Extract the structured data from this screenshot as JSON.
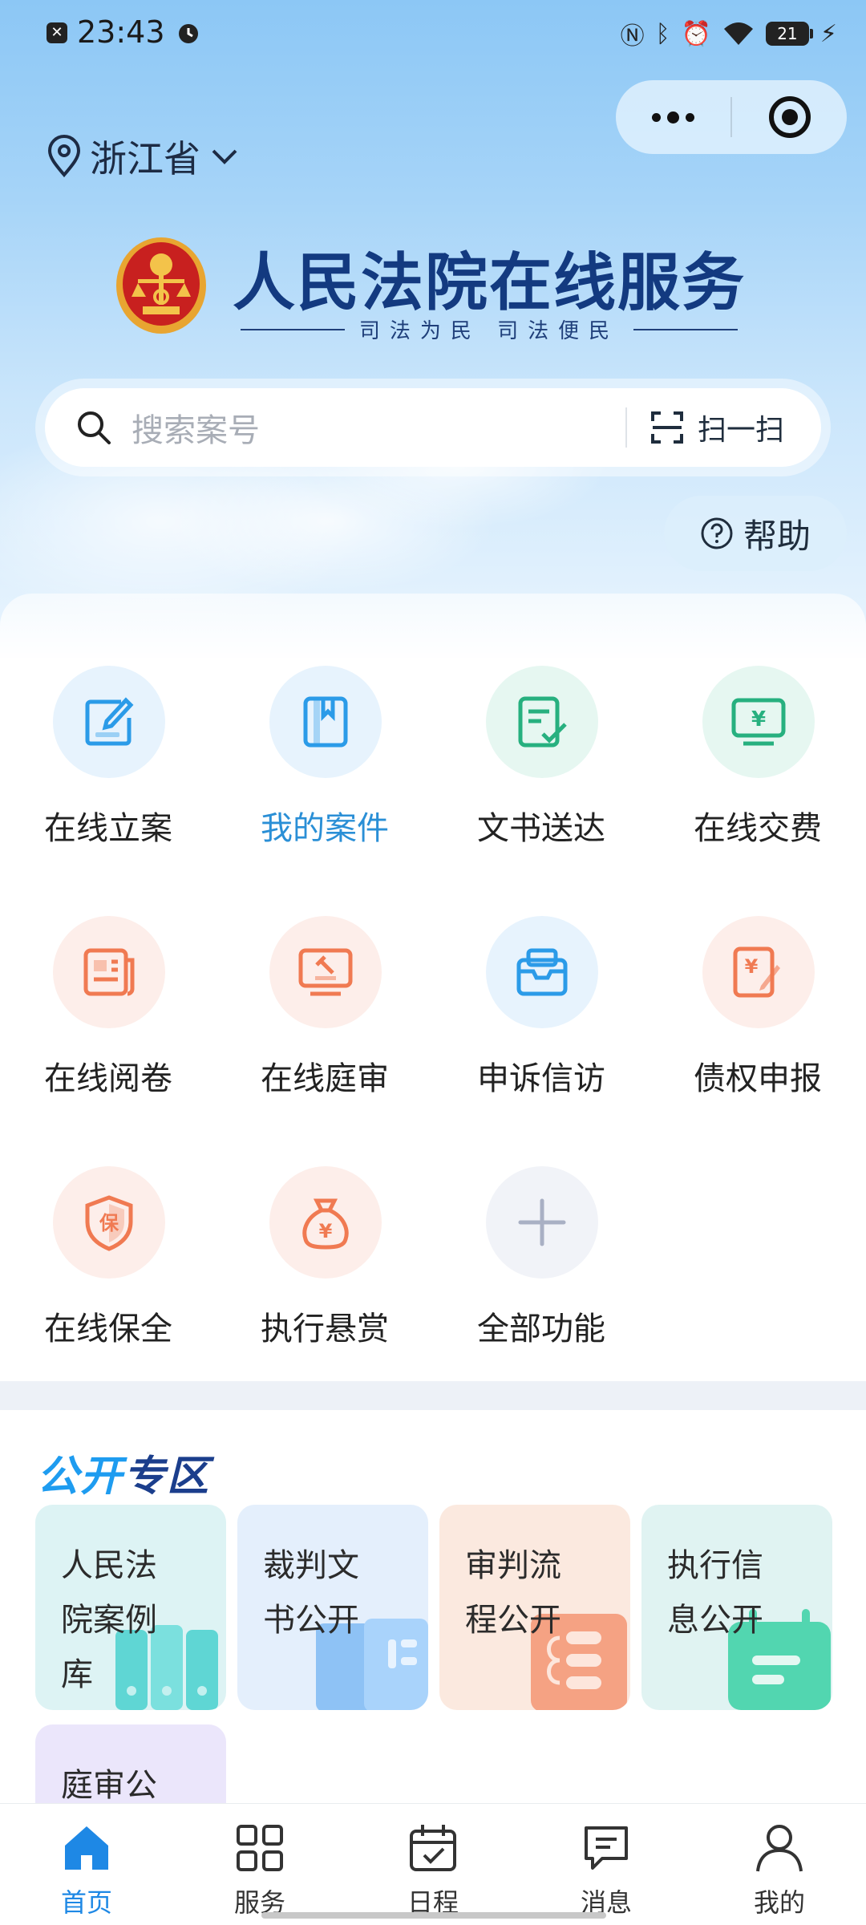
{
  "status_bar": {
    "time": "23:43",
    "battery": "21",
    "icons": [
      "nfc-icon",
      "bluetooth-icon",
      "alarm-icon",
      "wifi-icon",
      "battery-icon",
      "charging-icon"
    ]
  },
  "header": {
    "location": "浙江省",
    "title": "人民法院在线服务",
    "subtitle": "司法为民  司法便民"
  },
  "search": {
    "placeholder": "搜索案号",
    "scan_label": "扫一扫"
  },
  "help_label": "帮助",
  "services": [
    {
      "label": "在线立案",
      "icon": "edit-icon",
      "color": "#2b9be8"
    },
    {
      "label": "我的案件",
      "icon": "book-icon",
      "color": "#2b9be8",
      "active": true
    },
    {
      "label": "文书送达",
      "icon": "document-check-icon",
      "color": "#27b07f"
    },
    {
      "label": "在线交费",
      "icon": "payment-monitor-icon",
      "color": "#27b07f"
    },
    {
      "label": "在线阅卷",
      "icon": "newspaper-icon",
      "color": "#f07a52"
    },
    {
      "label": "在线庭审",
      "icon": "gavel-monitor-icon",
      "color": "#f07a52"
    },
    {
      "label": "申诉信访",
      "icon": "inbox-icon",
      "color": "#2b9be8"
    },
    {
      "label": "债权申报",
      "icon": "debt-form-icon",
      "color": "#f07a52"
    },
    {
      "label": "在线保全",
      "icon": "shield-icon",
      "color": "#f07a52"
    },
    {
      "label": "执行悬赏",
      "icon": "money-bag-icon",
      "color": "#f07a52"
    },
    {
      "label": "全部功能",
      "icon": "plus-icon",
      "color": "#a9b0c4"
    }
  ],
  "public_section": {
    "title_a": "公开",
    "title_b": "专区",
    "tiles": [
      {
        "label": "人民法院案例库",
        "color": "#ddf3f4"
      },
      {
        "label": "裁判文书公开",
        "color": "#e4effc"
      },
      {
        "label": "审判流程公开",
        "color": "#fbe9df"
      },
      {
        "label": "执行信息公开",
        "color": "#e0f3f2"
      },
      {
        "label": "庭审公",
        "color": "#ebe6fb"
      }
    ]
  },
  "tabbar": [
    {
      "label": "首页",
      "icon": "home-icon",
      "active": true
    },
    {
      "label": "服务",
      "icon": "grid-icon"
    },
    {
      "label": "日程",
      "icon": "calendar-icon"
    },
    {
      "label": "消息",
      "icon": "message-icon"
    },
    {
      "label": "我的",
      "icon": "user-icon"
    }
  ]
}
